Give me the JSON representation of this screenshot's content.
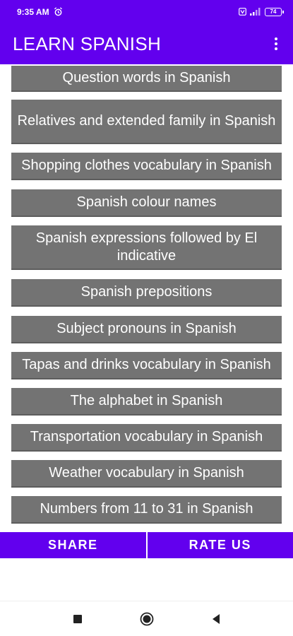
{
  "status_bar": {
    "time": "9:35 AM",
    "battery": "74",
    "icons": [
      "alarm-icon",
      "volte-icon",
      "signal-icon",
      "battery-icon"
    ]
  },
  "app_bar": {
    "title": "LEARN SPANISH",
    "menu_icon": "overflow-menu-icon"
  },
  "topics": [
    "Question words in Spanish",
    "Relatives and extended family in Spanish",
    "Shopping clothes vocabulary in Spanish",
    "Spanish colour names",
    "Spanish expressions followed by El indicative",
    "Spanish prepositions",
    "Subject pronouns in Spanish",
    "Tapas and drinks vocabulary in Spanish",
    "The alphabet in Spanish",
    "Transportation vocabulary in Spanish",
    "Weather vocabulary in Spanish",
    "Numbers from 11 to 31 in Spanish"
  ],
  "bottom_bar": {
    "share_label": "SHARE",
    "rate_label": "RATE US"
  },
  "nav_bar": {
    "icons": [
      "recents-icon",
      "home-icon",
      "back-icon"
    ]
  },
  "colors": {
    "primary": "#6200ee",
    "item_background": "#737373",
    "item_text": "#ffffff"
  }
}
